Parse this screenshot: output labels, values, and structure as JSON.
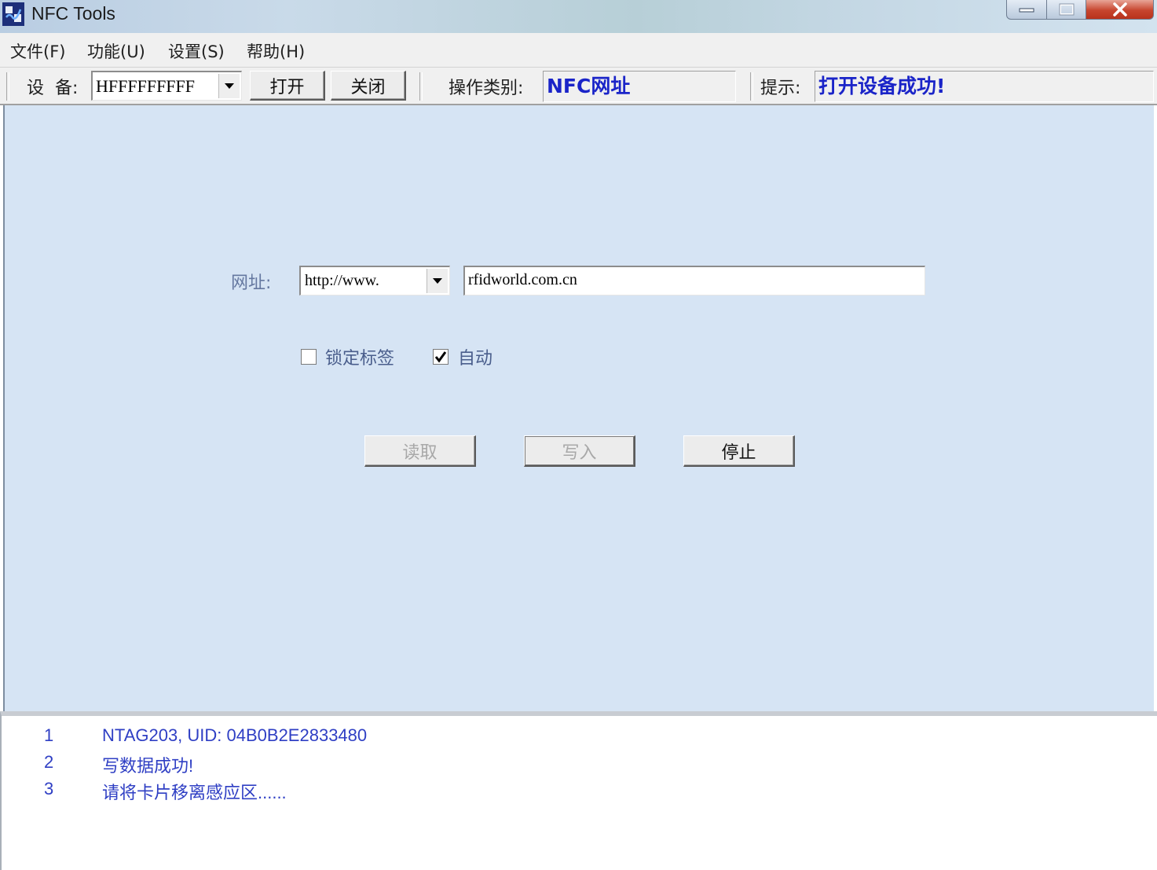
{
  "window": {
    "title": "NFC Tools"
  },
  "menu": {
    "items": [
      "文件(F)",
      "功能(U)",
      "设置(S)",
      "帮助(H)"
    ]
  },
  "toolbar": {
    "device_label": "设  备:",
    "device_value": "HFFFFFFFFF",
    "open_button": "打开",
    "close_button": "关闭",
    "op_type_label": "操作类别:",
    "op_type_value": "NFC网址",
    "hint_label": "提示:",
    "hint_value": "打开设备成功!"
  },
  "form": {
    "url_label": "网址:",
    "url_prefix_value": "http://www.",
    "url_value": "rfidworld.com.cn",
    "lock_label": "锁定标签",
    "lock_checked": false,
    "auto_label": "自动",
    "auto_checked": true,
    "read_button": "读取",
    "write_button": "写入",
    "stop_button": "停止"
  },
  "log": {
    "rows": [
      {
        "num": "1",
        "text": "NTAG203, UID: 04B0B2E2833480"
      },
      {
        "num": "2",
        "text": "写数据成功!"
      },
      {
        "num": "3",
        "text": "请将卡片移离感应区......"
      }
    ]
  },
  "colors": {
    "panel_bg": "#d6e4f4",
    "status_text": "#1a24c8",
    "log_text": "#2f3fc4"
  },
  "icons": [
    "app-icon",
    "minimize-icon",
    "maximize-icon",
    "close-icon",
    "dropdown-arrow-icon",
    "checkmark-icon"
  ]
}
